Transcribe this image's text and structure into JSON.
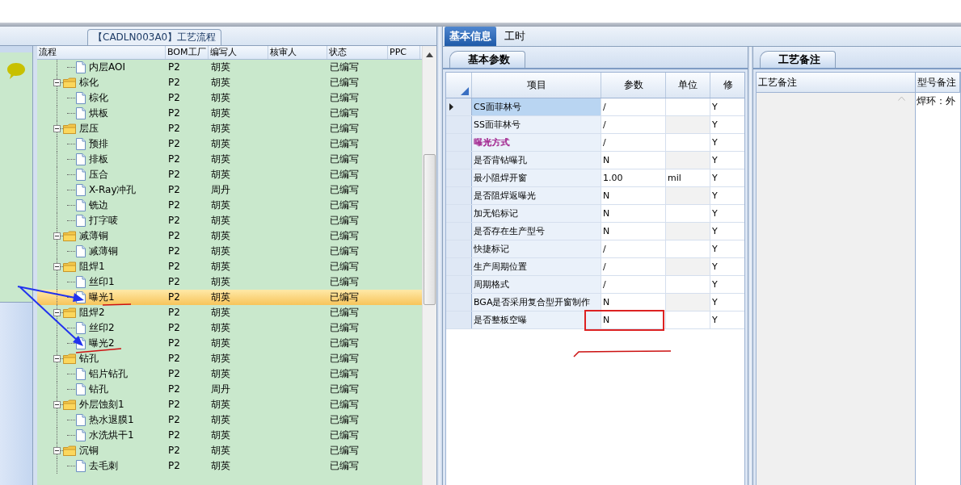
{
  "left_panel": {
    "title": "【CADLN003A0】工艺流程",
    "tree": {
      "columns": [
        "流程",
        "BOM工厂",
        "编写人",
        "核审人",
        "状态",
        "PPC"
      ],
      "rows": [
        {
          "kind": "step",
          "name": "内层AOI",
          "bom": "P2",
          "writer": "胡英",
          "status": "已编写",
          "selected": false
        },
        {
          "kind": "group",
          "name": "棕化",
          "bom": "P2",
          "writer": "胡英",
          "status": "已编写",
          "expanded": true,
          "selected": false,
          "children": [
            {
              "kind": "step",
              "name": "棕化",
              "bom": "P2",
              "writer": "胡英",
              "status": "已编写",
              "selected": false
            },
            {
              "kind": "step",
              "name": "烘板",
              "bom": "P2",
              "writer": "胡英",
              "status": "已编写",
              "selected": false
            }
          ]
        },
        {
          "kind": "group",
          "name": "层压",
          "bom": "P2",
          "writer": "胡英",
          "status": "已编写",
          "expanded": true,
          "selected": false,
          "children": [
            {
              "kind": "step",
              "name": "预排",
              "bom": "P2",
              "writer": "胡英",
              "status": "已编写",
              "selected": false
            },
            {
              "kind": "step",
              "name": "排板",
              "bom": "P2",
              "writer": "胡英",
              "status": "已编写",
              "selected": false
            },
            {
              "kind": "step",
              "name": "压合",
              "bom": "P2",
              "writer": "胡英",
              "status": "已编写",
              "selected": false
            },
            {
              "kind": "step",
              "name": "X-Ray冲孔",
              "bom": "P2",
              "writer": "周丹",
              "status": "已编写",
              "selected": false
            },
            {
              "kind": "step",
              "name": "铣边",
              "bom": "P2",
              "writer": "胡英",
              "status": "已编写",
              "selected": false
            },
            {
              "kind": "step",
              "name": "打字唛",
              "bom": "P2",
              "writer": "胡英",
              "status": "已编写",
              "selected": false
            }
          ]
        },
        {
          "kind": "group",
          "name": "减薄铜",
          "bom": "P2",
          "writer": "胡英",
          "status": "已编写",
          "expanded": true,
          "selected": false,
          "children": [
            {
              "kind": "step",
              "name": "减薄铜",
              "bom": "P2",
              "writer": "胡英",
              "status": "已编写",
              "selected": false
            }
          ]
        },
        {
          "kind": "group",
          "name": "阻焊1",
          "bom": "P2",
          "writer": "胡英",
          "status": "已编写",
          "expanded": true,
          "selected": false,
          "children": [
            {
              "kind": "step",
              "name": "丝印1",
              "bom": "P2",
              "writer": "胡英",
              "status": "已编写",
              "selected": false
            },
            {
              "kind": "step",
              "name": "曝光1",
              "bom": "P2",
              "writer": "胡英",
              "status": "已编写",
              "selected": true
            }
          ]
        },
        {
          "kind": "group",
          "name": "阻焊2",
          "bom": "P2",
          "writer": "胡英",
          "status": "已编写",
          "expanded": true,
          "selected": false,
          "children": [
            {
              "kind": "step",
              "name": "丝印2",
              "bom": "P2",
              "writer": "胡英",
              "status": "已编写",
              "selected": false
            },
            {
              "kind": "step",
              "name": "曝光2",
              "bom": "P2",
              "writer": "胡英",
              "status": "已编写",
              "selected": false
            }
          ]
        },
        {
          "kind": "group",
          "name": "钻孔",
          "bom": "P2",
          "writer": "胡英",
          "status": "已编写",
          "expanded": true,
          "selected": false,
          "children": [
            {
              "kind": "step",
              "name": "铝片钻孔",
              "bom": "P2",
              "writer": "胡英",
              "status": "已编写",
              "selected": false
            },
            {
              "kind": "step",
              "name": "钻孔",
              "bom": "P2",
              "writer": "周丹",
              "status": "已编写",
              "selected": false
            }
          ]
        },
        {
          "kind": "group",
          "name": "外层蚀刻1",
          "bom": "P2",
          "writer": "胡英",
          "status": "已编写",
          "expanded": true,
          "selected": false,
          "children": [
            {
              "kind": "step",
              "name": "热水退膜1",
              "bom": "P2",
              "writer": "胡英",
              "status": "已编写",
              "selected": false
            },
            {
              "kind": "step",
              "name": "水洗烘干1",
              "bom": "P2",
              "writer": "胡英",
              "status": "已编写",
              "selected": false
            }
          ]
        },
        {
          "kind": "group",
          "name": "沉铜",
          "bom": "P2",
          "writer": "胡英",
          "status": "已编写",
          "expanded": true,
          "selected": false,
          "children": [
            {
              "kind": "step",
              "name": "去毛刺",
              "bom": "P2",
              "writer": "胡英",
              "status": "已编写",
              "selected": false
            }
          ]
        }
      ]
    }
  },
  "tabs": [
    {
      "label": "基本信息",
      "selected": true
    },
    {
      "label": "工时",
      "selected": false
    }
  ],
  "params": {
    "tab": "基本参数",
    "columns": [
      "项目",
      "参数",
      "单位",
      "修"
    ],
    "rows": [
      {
        "item": "CS面菲林号",
        "value": "/",
        "modified": "Y",
        "selected": true
      },
      {
        "item": "SS面菲林号",
        "value": "/",
        "modified": "Y",
        "selected": false
      },
      {
        "item": "曝光方式",
        "value": "/",
        "modified": "Y",
        "color": "#a0208c",
        "selected": false
      },
      {
        "item": "是否背钻曝孔",
        "value": "N",
        "modified": "Y",
        "selected": false
      },
      {
        "item": "最小阻焊开窗",
        "value": "1.00",
        "unit": "mil",
        "modified": "Y",
        "selected": false
      },
      {
        "item": "是否阻焊返曝光",
        "value": "N",
        "modified": "Y",
        "selected": false
      },
      {
        "item": "加无铅标记",
        "value": "N",
        "modified": "Y",
        "selected": false
      },
      {
        "item": "是否存在生产型号",
        "value": "N",
        "modified": "Y",
        "selected": false
      },
      {
        "item": "快捷标记",
        "value": "/",
        "modified": "Y",
        "selected": false
      },
      {
        "item": "生产周期位置",
        "value": "/",
        "modified": "Y",
        "selected": false
      },
      {
        "item": "周期格式",
        "value": "/",
        "modified": "Y",
        "selected": false
      },
      {
        "item": "BGA是否采用复合型开窗制作",
        "value": "N",
        "modified": "Y",
        "selected": false
      },
      {
        "item": "是否整板空曝",
        "value": "N",
        "modified": "Y",
        "selected": false
      }
    ]
  },
  "notes": {
    "tab": "工艺备注",
    "columns": [
      "工艺备注",
      "型号备注"
    ],
    "model_note": "焊环：外"
  }
}
